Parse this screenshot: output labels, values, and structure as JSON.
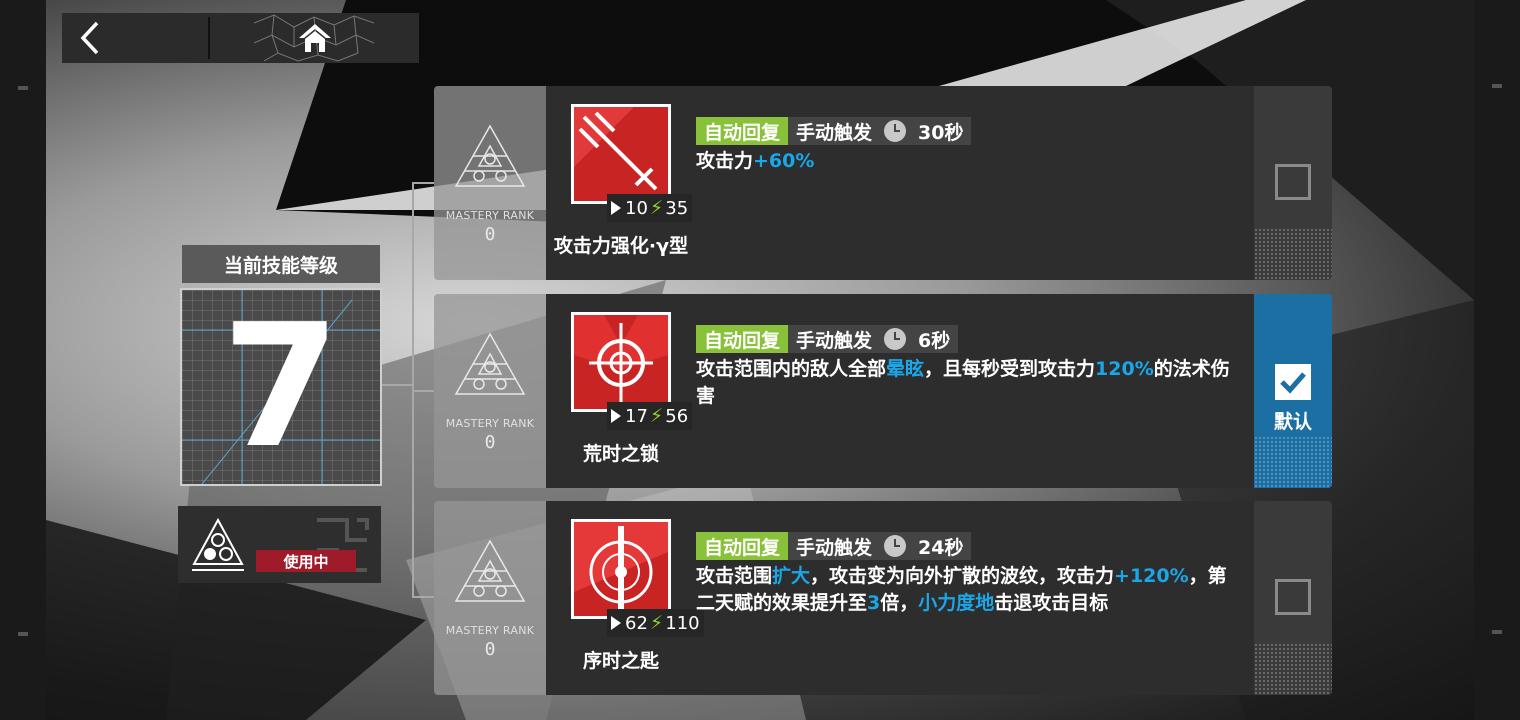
{
  "nav": {
    "back_icon": "chevron-left-icon",
    "home_icon": "home-icon"
  },
  "current_level": {
    "title": "当前技能等级",
    "value": "7"
  },
  "mastery_status": {
    "badge": "使用中"
  },
  "skills": [
    {
      "name": "攻击力强化·γ型",
      "sp_initial": "10",
      "sp_cost": "35",
      "tag_recovery": "自动回复",
      "tag_trigger": "手动触发",
      "duration": "30秒",
      "desc": [
        {
          "t": "攻击力",
          "hl": false
        },
        {
          "t": "+60%",
          "hl": true
        }
      ],
      "mastery_label": "MASTERY RANK",
      "mastery_value": "0",
      "selected": false
    },
    {
      "name": "荒时之锁",
      "sp_initial": "17",
      "sp_cost": "56",
      "tag_recovery": "自动回复",
      "tag_trigger": "手动触发",
      "duration": "6秒",
      "desc": [
        {
          "t": "攻击范围内的敌人全部",
          "hl": false
        },
        {
          "t": "晕眩",
          "hl": true
        },
        {
          "t": "，且每秒受到攻击力",
          "hl": false
        },
        {
          "t": "120%",
          "hl": true
        },
        {
          "t": "的法术伤害",
          "hl": false
        }
      ],
      "mastery_label": "MASTERY RANK",
      "mastery_value": "0",
      "selected": true,
      "selected_label": "默认"
    },
    {
      "name": "序时之匙",
      "sp_initial": "62",
      "sp_cost": "110",
      "tag_recovery": "自动回复",
      "tag_trigger": "手动触发",
      "duration": "24秒",
      "desc": [
        {
          "t": "攻击范围",
          "hl": false
        },
        {
          "t": "扩大",
          "hl": true
        },
        {
          "t": "，攻击变为向外扩散的波纹，攻击力",
          "hl": false
        },
        {
          "t": "+120%",
          "hl": true
        },
        {
          "t": "，第二天赋的效果提升至",
          "hl": false
        },
        {
          "t": "3",
          "hl": true
        },
        {
          "t": "倍，",
          "hl": false
        },
        {
          "t": "小力度地",
          "hl": true
        },
        {
          "t": "击退攻击目标",
          "hl": false
        }
      ],
      "mastery_label": "MASTERY RANK",
      "mastery_value": "0",
      "selected": false
    }
  ],
  "colors": {
    "accent_blue": "#1aa7e8",
    "tag_green": "#8ac13a",
    "selected_blue": "#1c6fa3",
    "in_use_red": "#a01b2a"
  }
}
